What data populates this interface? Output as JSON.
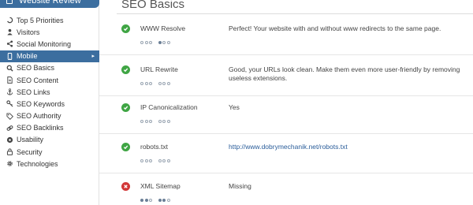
{
  "sidebar": {
    "header_title": "Website Review",
    "items": [
      {
        "label": "Top 5 Priorities",
        "icon": "priority-icon"
      },
      {
        "label": "Visitors",
        "icon": "visitors-icon"
      },
      {
        "label": "Social Monitoring",
        "icon": "share-icon"
      },
      {
        "label": "Mobile",
        "icon": "mobile-icon",
        "active": true
      },
      {
        "label": "SEO Basics",
        "icon": "search-icon"
      },
      {
        "label": "SEO Content",
        "icon": "document-icon"
      },
      {
        "label": "SEO Links",
        "icon": "anchor-icon"
      },
      {
        "label": "SEO Keywords",
        "icon": "key-icon"
      },
      {
        "label": "SEO Authority",
        "icon": "tag-icon"
      },
      {
        "label": "SEO Backlinks",
        "icon": "link-icon"
      },
      {
        "label": "Usability",
        "icon": "usability-icon"
      },
      {
        "label": "Security",
        "icon": "lock-icon"
      },
      {
        "label": "Technologies",
        "icon": "gear-icon"
      }
    ]
  },
  "main": {
    "title": "SEO Basics",
    "rows": [
      {
        "name": "WWW Resolve",
        "status": "pass",
        "result": "Perfect! Your website with and without www redirects to the same page.",
        "importance": 0,
        "difficulty": 1
      },
      {
        "name": "URL Rewrite",
        "status": "pass",
        "result": "Good, your URLs look clean. Make them even more user-friendly by removing useless extensions.",
        "importance": 0,
        "difficulty": 0
      },
      {
        "name": "IP Canonicalization",
        "status": "pass",
        "result": "Yes",
        "importance": 0,
        "difficulty": 0
      },
      {
        "name": "robots.txt",
        "status": "pass",
        "result": "http://www.dobrymechanik.net/robots.txt",
        "result_is_link": true,
        "importance": 0,
        "difficulty": 0
      },
      {
        "name": "XML Sitemap",
        "status": "fail",
        "result": "Missing",
        "importance": 2,
        "difficulty": 2
      }
    ]
  },
  "colors": {
    "accent": "#3c6e9f",
    "pass": "#3fa544",
    "fail": "#d23838",
    "link": "#2a5d9a"
  }
}
